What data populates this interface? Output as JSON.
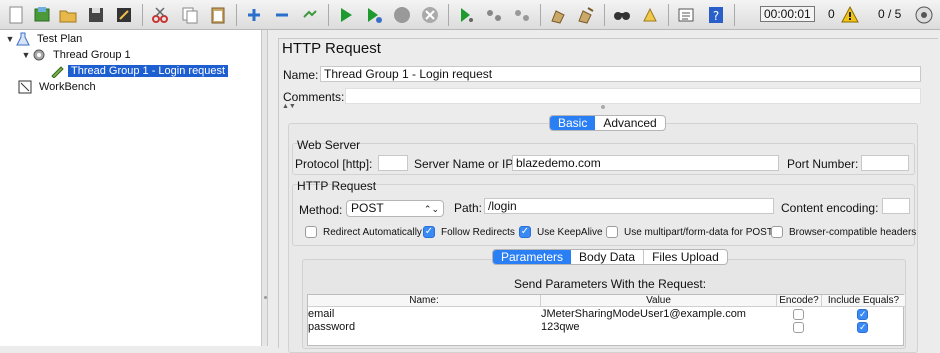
{
  "toolbar": {
    "timer": "00:00:01",
    "warnings": "0",
    "threads": "0 / 5"
  },
  "tree": {
    "items": [
      {
        "label": "Test Plan"
      },
      {
        "label": "Thread Group 1"
      },
      {
        "label": "Thread Group 1 - Login request"
      },
      {
        "label": "WorkBench"
      }
    ]
  },
  "panel": {
    "title": "HTTP Request",
    "name_label": "Name:",
    "name_value": "Thread Group 1 - Login request",
    "comments_label": "Comments:",
    "tabs": [
      {
        "label": "Basic",
        "active": true
      },
      {
        "label": "Advanced",
        "active": false
      }
    ],
    "web_server": {
      "title": "Web Server",
      "protocol_label": "Protocol [http]:",
      "protocol_value": "",
      "server_label": "Server Name or IP:",
      "server_value": "blazedemo.com",
      "port_label": "Port Number:",
      "port_value": ""
    },
    "http_request": {
      "title": "HTTP Request",
      "method_label": "Method:",
      "method_value": "POST",
      "path_label": "Path:",
      "path_value": "/login",
      "encoding_label": "Content encoding:",
      "encoding_value": ""
    },
    "options": [
      {
        "label": "Redirect Automatically",
        "checked": false
      },
      {
        "label": "Follow Redirects",
        "checked": true
      },
      {
        "label": "Use KeepAlive",
        "checked": true
      },
      {
        "label": "Use multipart/form-data for POST",
        "checked": false
      },
      {
        "label": "Browser-compatible headers",
        "checked": false
      }
    ],
    "subtabs": [
      {
        "label": "Parameters",
        "active": true
      },
      {
        "label": "Body Data",
        "active": false
      },
      {
        "label": "Files Upload",
        "active": false
      }
    ],
    "params_title": "Send Parameters With the Request:",
    "table": {
      "headers": [
        "Name:",
        "Value",
        "Encode?",
        "Include Equals?"
      ],
      "rows": [
        {
          "name": "email",
          "value": "JMeterSharingModeUser1@example.com",
          "encode": false,
          "include_equals": true
        },
        {
          "name": "password",
          "value": "123qwe",
          "encode": false,
          "include_equals": true
        }
      ]
    }
  },
  "colors": {
    "selection": "#1d5fd1",
    "accent": "#2a7ff5"
  }
}
